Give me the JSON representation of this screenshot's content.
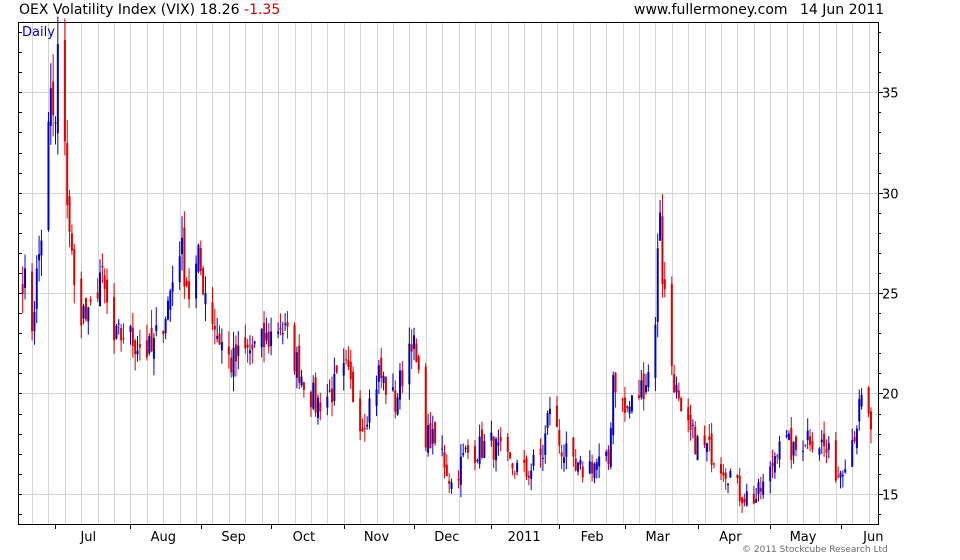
{
  "header": {
    "title": "OEX Volatility Index (VIX) 18.26",
    "change": "-1.35",
    "website": "www.fullermoney.com",
    "date": "14 Jun 2011"
  },
  "footer": {
    "copyright": "© 2011 Stockcube Research Ltd"
  },
  "colors": {
    "up": "#0000cc",
    "down": "#dd0000",
    "grid": "#d4d4d4",
    "axis": "#000000",
    "period": "#0000cc"
  },
  "chart_data": {
    "type": "candlestick",
    "period_label": "Daily",
    "ylim": [
      13.5,
      38.5
    ],
    "yticks": [
      15,
      20,
      25,
      30,
      35
    ],
    "x_range": [
      "2010-06-15",
      "2011-06-17"
    ],
    "months": [
      {
        "label": "Jul",
        "date": "2010-07-01"
      },
      {
        "label": "Aug",
        "date": "2010-08-02"
      },
      {
        "label": "Sep",
        "date": "2010-09-01"
      },
      {
        "label": "Oct",
        "date": "2010-10-01"
      },
      {
        "label": "Nov",
        "date": "2010-11-01"
      },
      {
        "label": "Dec",
        "date": "2010-12-01"
      },
      {
        "label": "2011",
        "date": "2011-01-03"
      },
      {
        "label": "Feb",
        "date": "2011-02-01"
      },
      {
        "label": "Mar",
        "date": "2011-03-01"
      },
      {
        "label": "Apr",
        "date": "2011-04-01"
      },
      {
        "label": "May",
        "date": "2011-05-02"
      },
      {
        "label": "Jun",
        "date": "2011-06-01"
      }
    ],
    "anchors": [
      [
        "2010-06-17",
        26
      ],
      [
        "2010-06-21",
        23.5
      ],
      [
        "2010-06-25",
        28
      ],
      [
        "2010-06-29",
        34.5
      ],
      [
        "2010-07-01",
        33
      ],
      [
        "2010-07-02",
        37
      ],
      [
        "2010-07-06",
        30
      ],
      [
        "2010-07-09",
        25
      ],
      [
        "2010-07-15",
        23.5
      ],
      [
        "2010-07-20",
        26
      ],
      [
        "2010-07-26",
        22.5
      ],
      [
        "2010-07-30",
        23
      ],
      [
        "2010-08-05",
        22.5
      ],
      [
        "2010-08-11",
        22
      ],
      [
        "2010-08-18",
        24.5
      ],
      [
        "2010-08-23",
        27.5
      ],
      [
        "2010-08-27",
        25
      ],
      [
        "2010-08-31",
        26.5
      ],
      [
        "2010-09-08",
        23
      ],
      [
        "2010-09-14",
        21.5
      ],
      [
        "2010-09-20",
        22
      ],
      [
        "2010-09-28",
        22.5
      ],
      [
        "2010-10-05",
        23.5
      ],
      [
        "2010-10-12",
        21.5
      ],
      [
        "2010-10-20",
        19.5
      ],
      [
        "2010-10-26",
        20
      ],
      [
        "2010-11-02",
        21
      ],
      [
        "2010-11-09",
        18.5
      ],
      [
        "2010-11-16",
        21
      ],
      [
        "2010-11-23",
        19.5
      ],
      [
        "2010-11-30",
        23
      ],
      [
        "2010-12-06",
        18
      ],
      [
        "2010-12-13",
        17
      ],
      [
        "2010-12-17",
        15.5
      ],
      [
        "2010-12-23",
        17
      ],
      [
        "2011-01-03",
        17.5
      ],
      [
        "2011-01-10",
        16.5
      ],
      [
        "2011-01-18",
        16
      ],
      [
        "2011-01-25",
        17
      ],
      [
        "2011-01-28",
        19.5
      ],
      [
        "2011-02-01",
        17.5
      ],
      [
        "2011-02-08",
        16
      ],
      [
        "2011-02-15",
        16.5
      ],
      [
        "2011-02-22",
        16.5
      ],
      [
        "2011-02-24",
        21
      ],
      [
        "2011-03-01",
        19
      ],
      [
        "2011-03-07",
        20
      ],
      [
        "2011-03-11",
        21
      ],
      [
        "2011-03-14",
        24
      ],
      [
        "2011-03-16",
        29.5
      ],
      [
        "2011-03-17",
        26
      ],
      [
        "2011-03-21",
        21.5
      ],
      [
        "2011-03-25",
        18.5
      ],
      [
        "2011-04-01",
        17.5
      ],
      [
        "2011-04-08",
        17
      ],
      [
        "2011-04-15",
        16
      ],
      [
        "2011-04-19",
        15
      ],
      [
        "2011-04-26",
        14.8
      ],
      [
        "2011-05-02",
        16
      ],
      [
        "2011-05-06",
        18
      ],
      [
        "2011-05-12",
        17
      ],
      [
        "2011-05-18",
        18
      ],
      [
        "2011-05-24",
        17.5
      ],
      [
        "2011-05-31",
        16
      ],
      [
        "2011-06-06",
        17.8
      ],
      [
        "2011-06-10",
        19.5
      ],
      [
        "2011-06-14",
        18.3
      ]
    ]
  }
}
